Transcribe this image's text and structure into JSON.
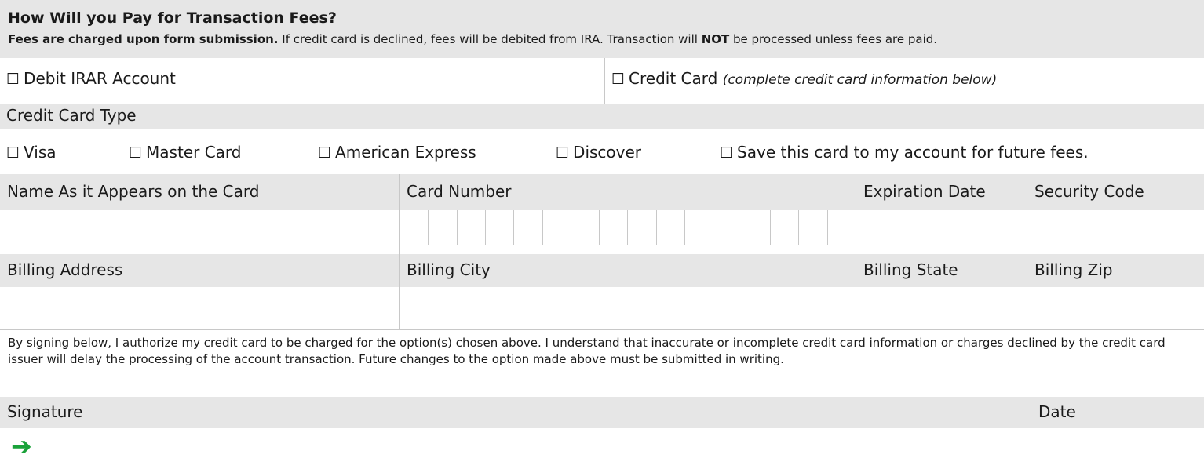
{
  "header": {
    "title": "How Will you Pay for Transaction Fees?",
    "notice_bold": "Fees are charged upon form submission.",
    "notice_text1": " If credit card is declined, fees will be debited from IRA. Transaction will ",
    "notice_not": "NOT",
    "notice_text2": " be processed unless fees are paid."
  },
  "payment_method": {
    "debit": "Debit IRAR Account",
    "credit": "Credit Card",
    "credit_note": "(complete credit card information below)"
  },
  "card_type": {
    "heading": "Credit Card Type",
    "options": [
      "Visa",
      "Master Card",
      "American Express",
      "Discover"
    ],
    "save": "Save this card to my account for future fees."
  },
  "card_fields": {
    "name": "Name As it Appears on the Card",
    "number": "Card Number",
    "expiration": "Expiration Date",
    "security": "Security Code"
  },
  "billing_fields": {
    "address": "Billing Address",
    "city": "Billing City",
    "state": "Billing State",
    "zip": "Billing Zip"
  },
  "authorization": "By signing below, I authorize my credit card to be charged for the option(s) chosen above. I understand that inaccurate or incomplete credit card information or charges declined by the credit card issuer will delay the processing of the account transaction. Future changes to the option made above must be submitted in writing.",
  "signature": {
    "label": "Signature",
    "date": "Date"
  },
  "glyphs": {
    "checkbox": "☐",
    "arrow": "➔"
  },
  "colors": {
    "arrow": "#1aa23a",
    "band": "#e6e6e6"
  }
}
